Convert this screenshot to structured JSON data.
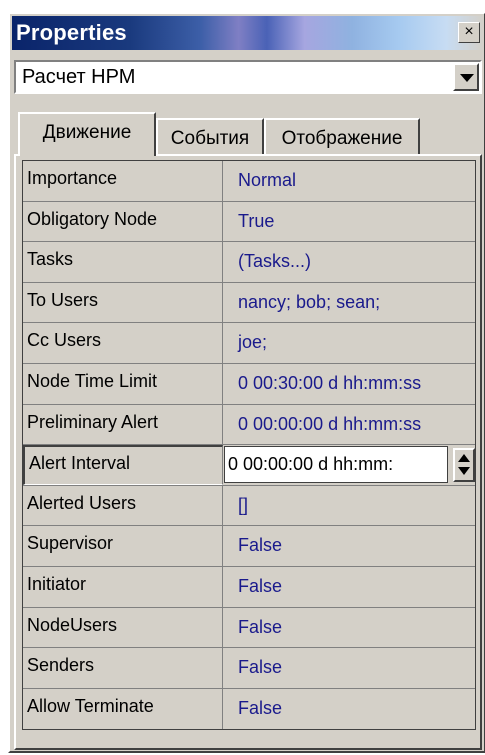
{
  "window": {
    "title": "Properties",
    "close_glyph": "×",
    "close_icon": "close-icon"
  },
  "object_selector": {
    "value": "Расчет НРМ",
    "dropdown_icon": "chevron-down-icon"
  },
  "tabs": [
    {
      "label": "Движение",
      "active": true
    },
    {
      "label": "События",
      "active": false
    },
    {
      "label": "Отображение",
      "active": false
    }
  ],
  "properties": [
    {
      "name": "Importance",
      "value": "Normal"
    },
    {
      "name": "Obligatory Node",
      "value": "True"
    },
    {
      "name": "Tasks",
      "value": "(Tasks...)"
    },
    {
      "name": "To Users",
      "value": "nancy; bob; sean;"
    },
    {
      "name": "Cc Users",
      "value": "joe;"
    },
    {
      "name": "Node Time Limit",
      "value": "0 00:30:00 d hh:mm:ss"
    },
    {
      "name": "Preliminary Alert",
      "value": "0 00:00:00 d hh:mm:ss"
    },
    {
      "name": "Alert Interval",
      "value": "0 00:00:00 d hh:mm:",
      "editing": true
    },
    {
      "name": "Alerted Users",
      "value": "[]"
    },
    {
      "name": "Supervisor",
      "value": "False"
    },
    {
      "name": "Initiator",
      "value": "False"
    },
    {
      "name": "NodeUsers",
      "value": "False"
    },
    {
      "name": "Senders",
      "value": "False"
    },
    {
      "name": "Allow Terminate",
      "value": "False"
    }
  ],
  "colors": {
    "titlebar_start": "#0a246a",
    "face": "#d4d0c8",
    "value_text": "#1a1a8c"
  }
}
